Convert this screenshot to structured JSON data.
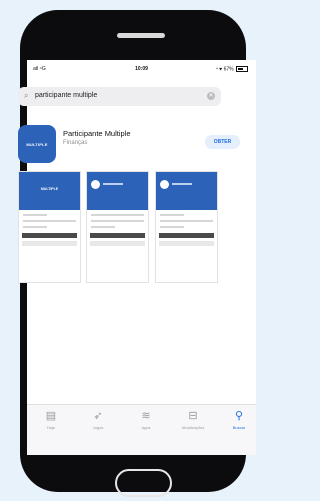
{
  "status_bar": {
    "carrier": "atl ⁴G",
    "time": "10:09",
    "indicators": "⁴ ♥ 67%"
  },
  "search": {
    "query": "participante multiple"
  },
  "app": {
    "icon_text": "MULTIPLE",
    "name": "Participante Multiple",
    "category": "Finanças",
    "get_label": "OBTER",
    "accent_color": "#2c63b8"
  },
  "screenshots": [
    {
      "brand": "MULTIPLE"
    },
    {
      "brand": ""
    },
    {
      "brand": ""
    }
  ],
  "tabs": [
    {
      "icon": "today-icon",
      "label": "Hoje"
    },
    {
      "icon": "games-icon",
      "label": "Jogos"
    },
    {
      "icon": "apps-icon",
      "label": "Apps"
    },
    {
      "icon": "arcade-icon",
      "label": "Atualizações"
    },
    {
      "icon": "search-icon",
      "label": "Buscar",
      "active": true
    }
  ]
}
